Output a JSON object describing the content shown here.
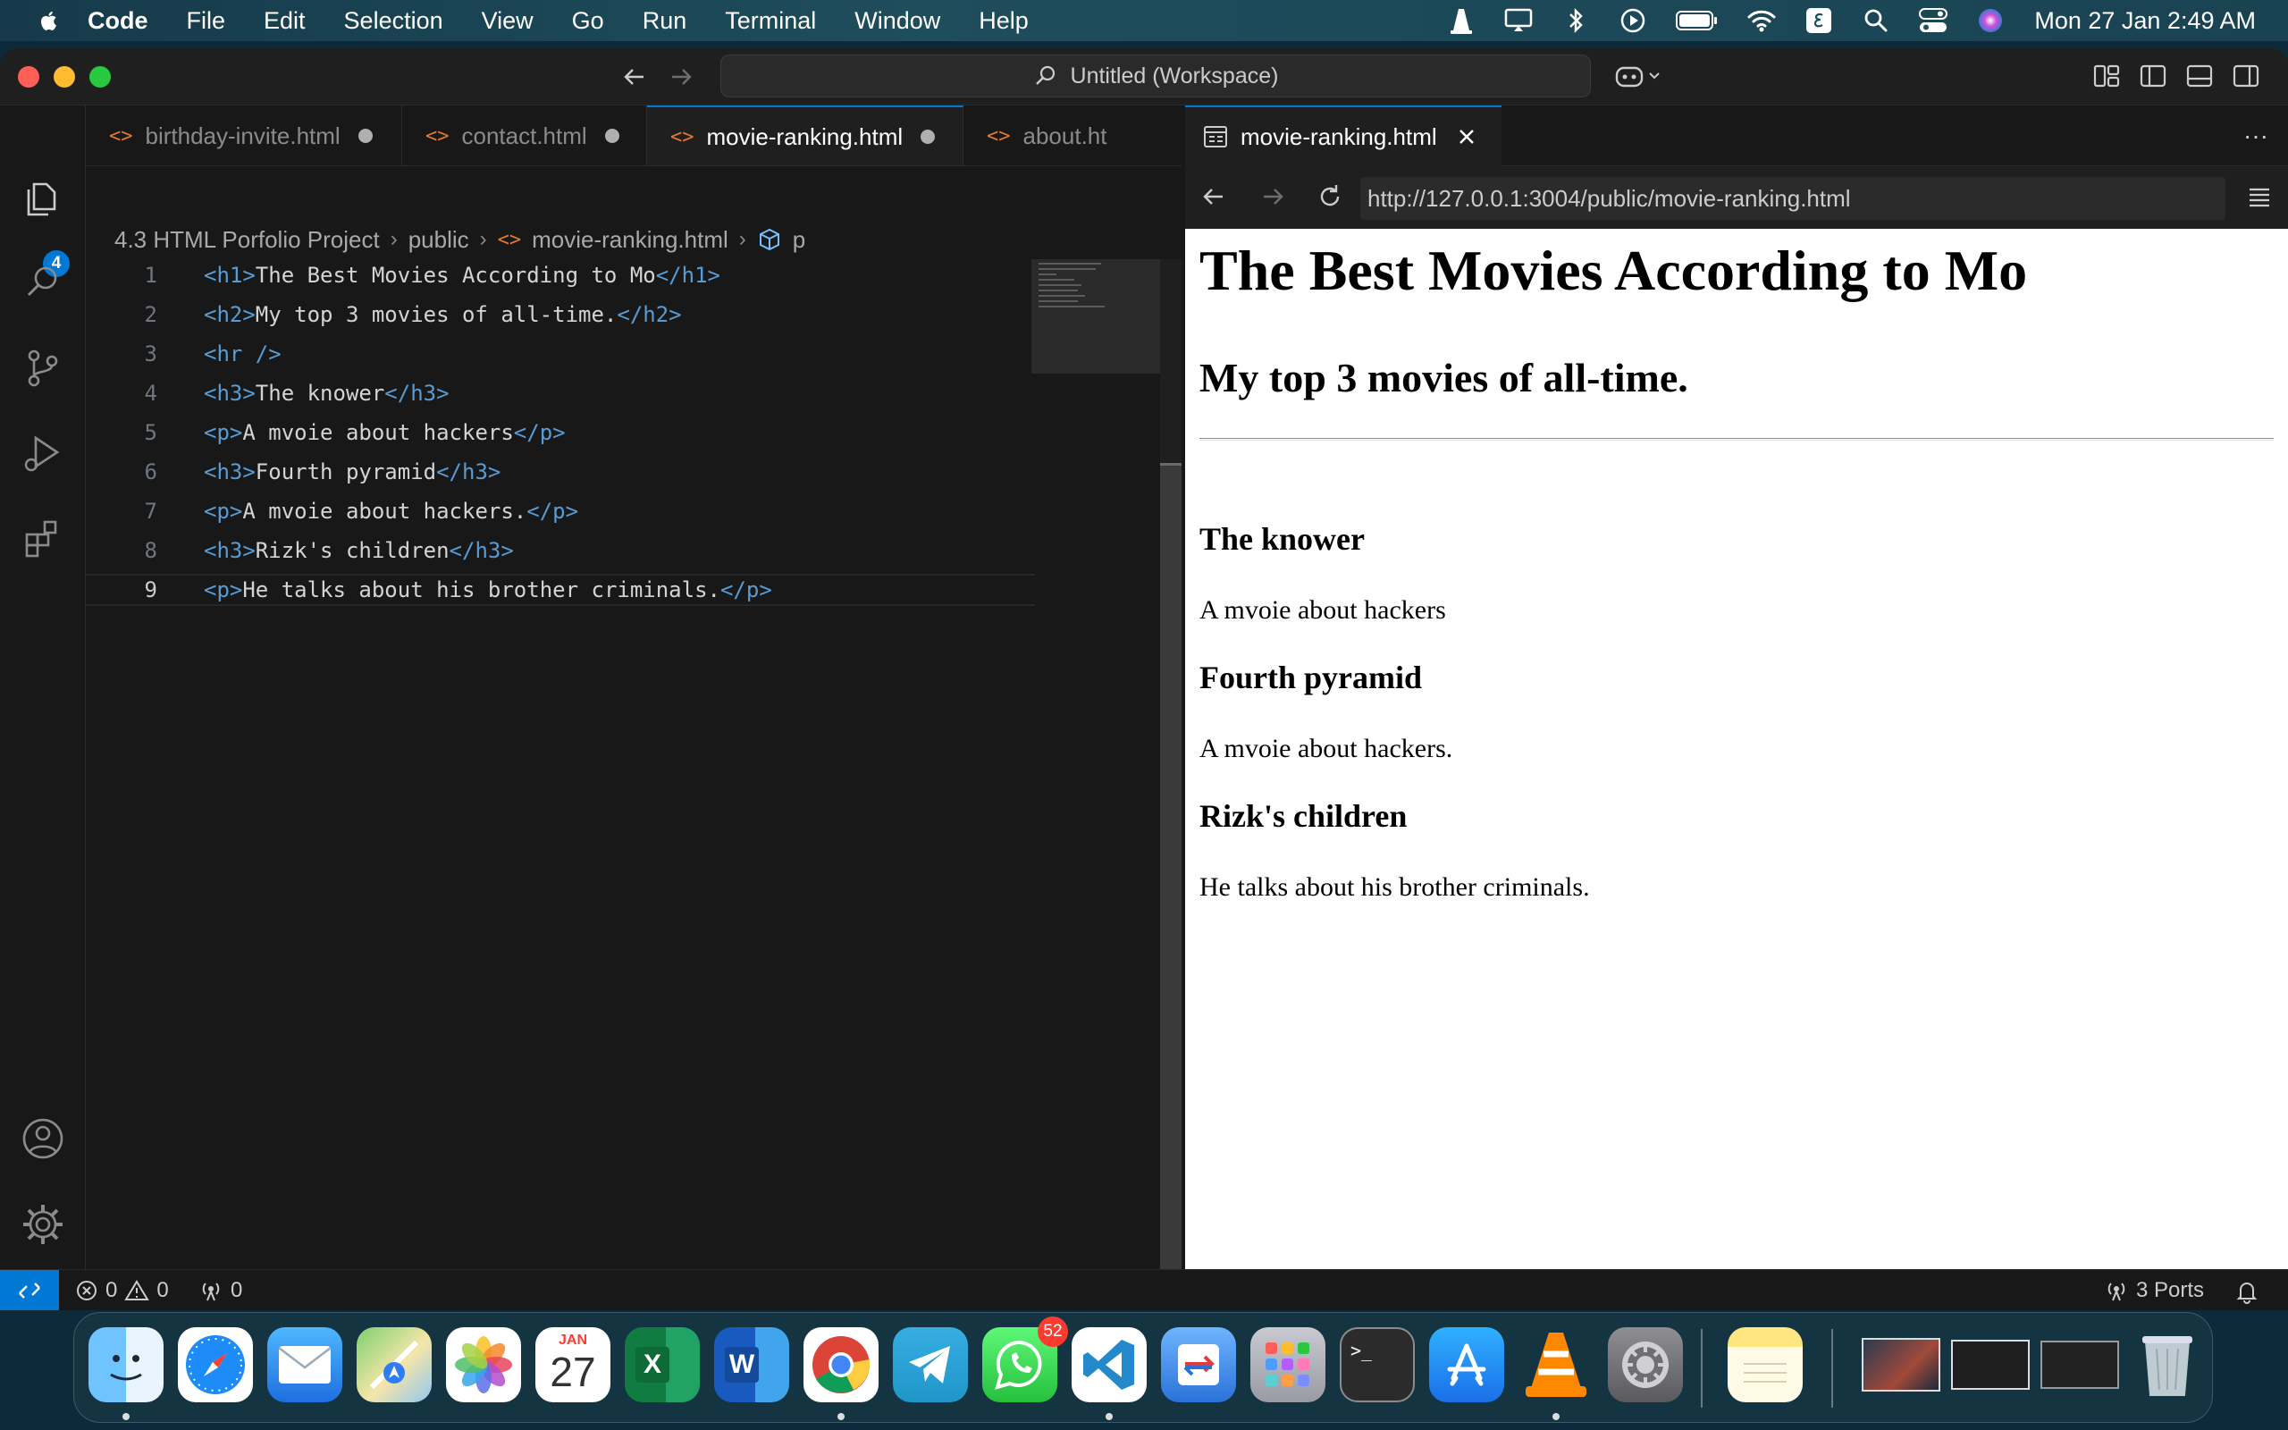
{
  "menubar": {
    "app_name": "Code",
    "items": [
      "File",
      "Edit",
      "Selection",
      "View",
      "Go",
      "Run",
      "Terminal",
      "Window",
      "Help"
    ],
    "clock": "Mon 27 Jan  2:49 AM"
  },
  "titlebar": {
    "command_center": "Untitled (Workspace)"
  },
  "activity": {
    "explorer_badge": "4"
  },
  "editor": {
    "tabs": [
      {
        "label": "birthday-invite.html",
        "dirty": true
      },
      {
        "label": "contact.html",
        "dirty": true
      },
      {
        "label": "movie-ranking.html",
        "dirty": true,
        "active": true
      },
      {
        "label": "about.ht",
        "dirty": false
      }
    ],
    "more": "···",
    "breadcrumb": [
      "4.3 HTML Porfolio Project",
      "public",
      "movie-ranking.html",
      "p"
    ],
    "lines": [
      {
        "n": "1",
        "open": "<h1>",
        "text": "The Best Movies According to Mo",
        "close": "</h1>"
      },
      {
        "n": "2",
        "open": "<h2>",
        "text": "My top 3 movies of all-time.",
        "close": "</h2>"
      },
      {
        "n": "3",
        "open": "<hr />",
        "text": "",
        "close": ""
      },
      {
        "n": "4",
        "open": "<h3>",
        "text": "The knower",
        "close": "</h3>"
      },
      {
        "n": "5",
        "open": "<p>",
        "text": "A mvoie about hackers",
        "close": "</p>"
      },
      {
        "n": "6",
        "open": "<h3>",
        "text": "Fourth pyramid",
        "close": "</h3>"
      },
      {
        "n": "7",
        "open": "<p>",
        "text": "A mvoie about hackers.",
        "close": "</p>"
      },
      {
        "n": "8",
        "open": "<h3>",
        "text": "Rizk's children",
        "close": "</h3>"
      },
      {
        "n": "9",
        "open": "<p>",
        "text": "He talks about his brother criminals.",
        "close": "</p>"
      }
    ]
  },
  "browser": {
    "tab_label": "movie-ranking.html",
    "url": "http://127.0.0.1:3004/public/movie-ranking.html",
    "page": {
      "h1": "The Best Movies According to Mo",
      "h2": "My top 3 movies of all-time.",
      "sections": [
        {
          "title": "The knower",
          "desc": "A mvoie about hackers"
        },
        {
          "title": "Fourth pyramid",
          "desc": "A mvoie about hackers."
        },
        {
          "title": "Rizk's children",
          "desc": "He talks about his brother criminals."
        }
      ]
    }
  },
  "statusbar": {
    "errors": "0",
    "warnings": "0",
    "ports_count": "0",
    "ports_label": "3 Ports"
  },
  "dock": {
    "calendar_month": "JAN",
    "calendar_day": "27",
    "whatsapp_badge": "52",
    "apps": [
      "Finder",
      "Safari",
      "Mail",
      "Maps",
      "Photos",
      "Calendar",
      "Excel",
      "Word",
      "Chrome",
      "Telegram",
      "WhatsApp",
      "Visual Studio Code",
      "Remote Desktop",
      "Launchpad",
      "Terminal",
      "App Store",
      "VLC",
      "System Settings",
      "Notes"
    ]
  },
  "colors": {
    "accent": "#0078d4",
    "html_icon": "#e37933",
    "tag": "#569cd6"
  }
}
